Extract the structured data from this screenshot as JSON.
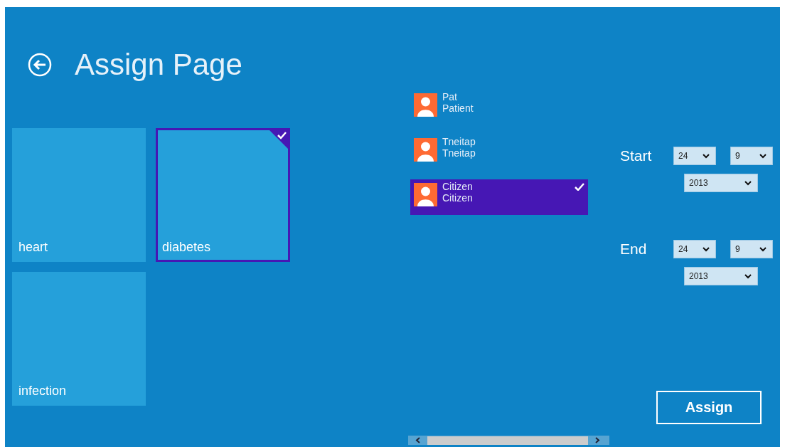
{
  "window": {
    "title": "Assign Page"
  },
  "categories": [
    {
      "label": "heart",
      "selected": false
    },
    {
      "label": "diabetes",
      "selected": true
    },
    {
      "label": "infection",
      "selected": false
    }
  ],
  "people": [
    {
      "first": "Pat",
      "last": "Patient",
      "selected": false
    },
    {
      "first": "Tneitap",
      "last": "Tneitap",
      "selected": false
    },
    {
      "first": "Citizen",
      "last": "Citizen",
      "selected": true
    }
  ],
  "dates": [
    {
      "label": "Start",
      "day": "24",
      "month": "9",
      "year": "2013"
    },
    {
      "label": "End",
      "day": "24",
      "month": "9",
      "year": "2013"
    }
  ],
  "assign_button": "Assign"
}
